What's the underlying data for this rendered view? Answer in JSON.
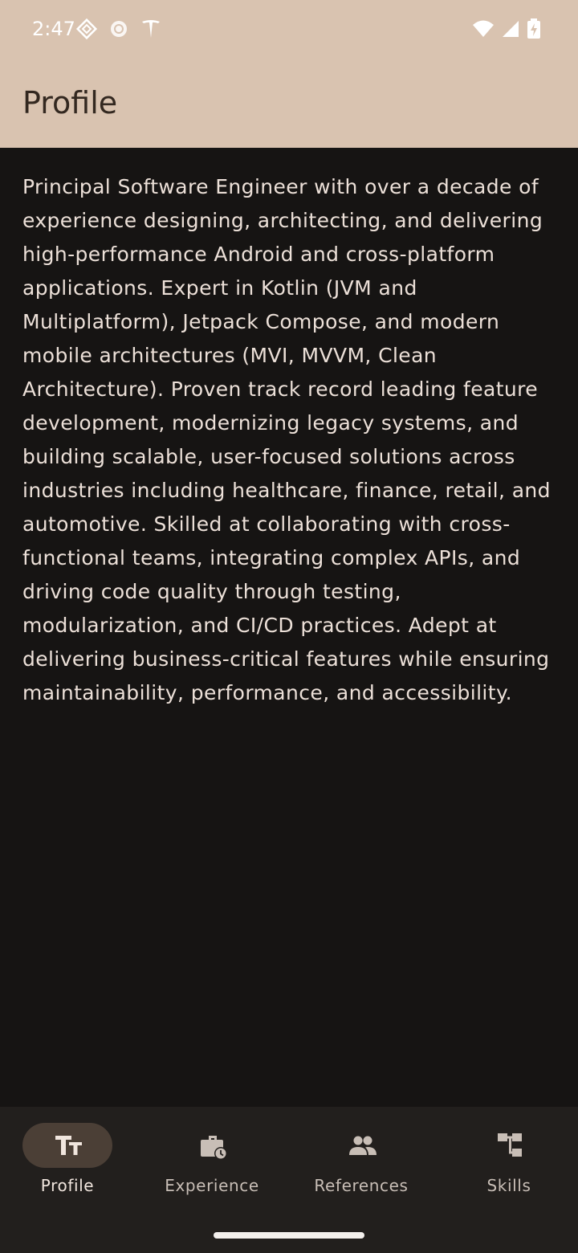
{
  "status_bar": {
    "time": "2:47",
    "icons_left": [
      "notification-diamond-icon",
      "notification-circle-icon",
      "tesla-logo-icon"
    ],
    "icons_right": [
      "wifi-icon",
      "cellular-signal-icon",
      "battery-charging-icon"
    ]
  },
  "app_bar": {
    "title": "Profile"
  },
  "profile": {
    "summary": "Principal Software Engineer with over a decade of experience designing, architecting, and delivering high-performance Android and cross-platform applications. Expert in Kotlin (JVM and Multiplatform), Jetpack Compose, and modern mobile architectures (MVI, MVVM, Clean Architecture). Proven track record leading feature development, modernizing legacy systems, and building scalable, user-focused solutions across industries including healthcare, finance, retail, and automotive. Skilled at collaborating with cross-functional teams, integrating complex APIs, and driving code quality through testing, modularization, and CI/CD practices. Adept at delivering business-critical features while ensuring maintainability, performance, and accessibility."
  },
  "bottom_nav": {
    "items": [
      {
        "label": "Profile",
        "icon": "text-fields-icon",
        "selected": true
      },
      {
        "label": "Experience",
        "icon": "work-history-icon",
        "selected": false
      },
      {
        "label": "References",
        "icon": "people-icon",
        "selected": false
      },
      {
        "label": "Skills",
        "icon": "account-tree-icon",
        "selected": false
      }
    ]
  },
  "colors": {
    "app_bar_bg": "#d9c3b0",
    "content_bg": "#161413",
    "nav_bg": "#221f1d",
    "active_pill": "#4b3f36",
    "text_primary": "#ece0d8"
  }
}
